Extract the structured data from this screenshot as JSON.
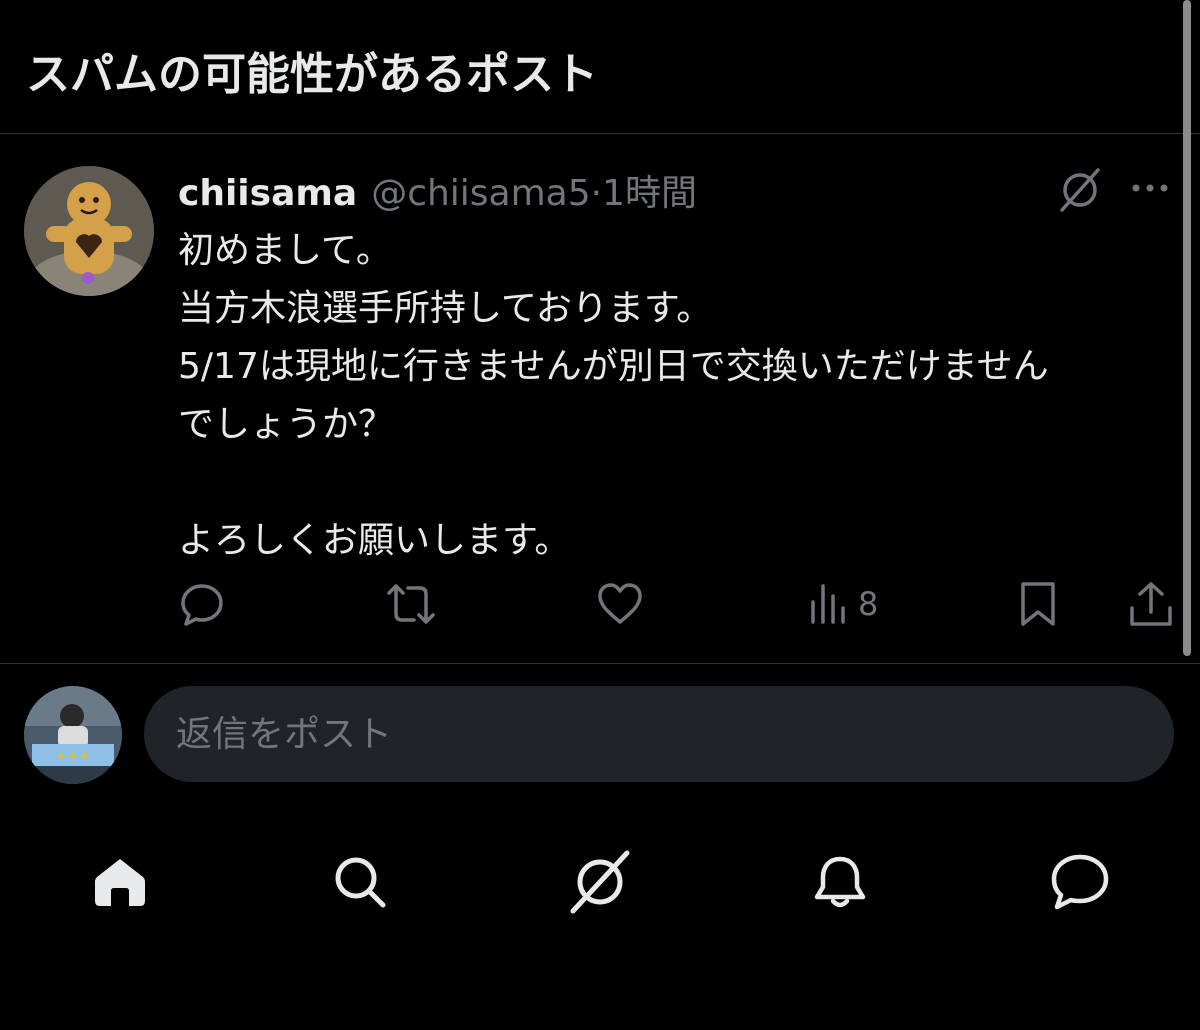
{
  "header": {
    "title": "スパムの可能性があるポスト"
  },
  "post": {
    "display_name": "chiisama",
    "handle": "@chiisama5",
    "separator": "·",
    "time": "1時間",
    "lines": [
      "初めまして。",
      "当方木浪選手所持しております。",
      "5/17は現地に行きませんが別日で交換いただけません",
      "でしょうか？",
      "",
      "よろしくお願いします。"
    ],
    "views_count": "8"
  },
  "reply": {
    "placeholder": "返信をポスト"
  },
  "colors": {
    "background": "#000000",
    "text": "#e7e9ea",
    "muted": "#71767b",
    "input_bg": "#202327",
    "divider": "#2f3336"
  },
  "icons": {
    "post": [
      "grok-icon",
      "more-icon"
    ],
    "actions": [
      "reply-icon",
      "repost-icon",
      "like-icon",
      "views-icon",
      "bookmark-icon",
      "share-icon"
    ],
    "tabs": [
      "home-icon",
      "search-icon",
      "grok-icon",
      "notifications-icon",
      "messages-icon"
    ]
  }
}
